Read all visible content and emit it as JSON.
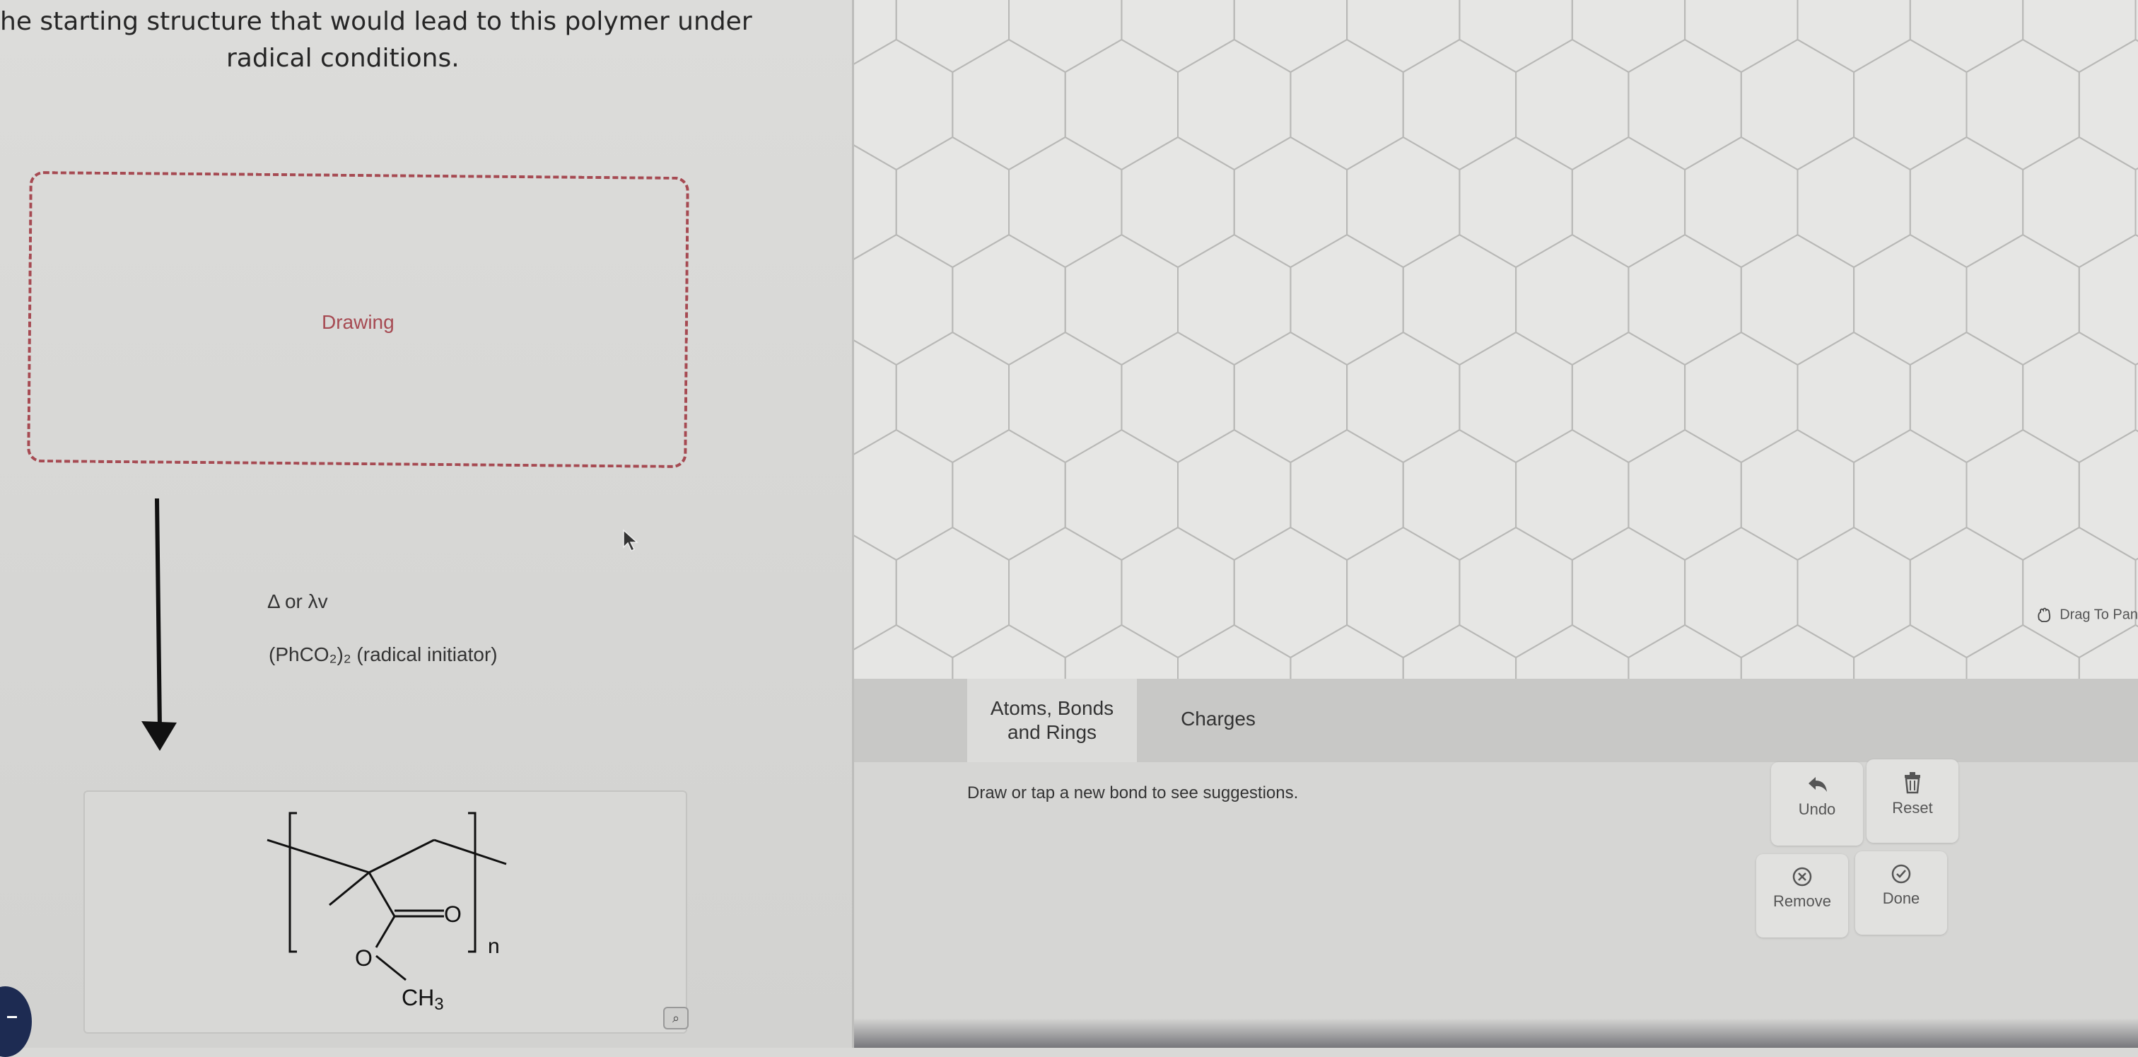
{
  "question": {
    "line1": "he starting structure that would lead to this polymer under",
    "line2": "radical conditions."
  },
  "drawing_placeholder": "Drawing",
  "conditions": {
    "heat_or_light": "Δ or λv",
    "initiator": "(PhCO₂)₂ (radical initiator)"
  },
  "product": {
    "carbonyl_oxygen": "O",
    "ester_oxygen": "O",
    "methyl": "CH",
    "methyl_sub": "3",
    "repeat": "n"
  },
  "editor": {
    "drag_hint": "Drag To Pan",
    "tabs": [
      {
        "label": "Atoms, Bonds and Rings",
        "selected": true
      },
      {
        "label": "Charges",
        "selected": false
      }
    ],
    "suggestion": "Draw or tap a new bond to see suggestions.",
    "buttons": {
      "undo": "Undo",
      "reset": "Reset",
      "remove": "Remove",
      "done": "Done"
    }
  },
  "colors": {
    "dashed_border": "#a64a52",
    "hex_grid_line": "#b8b8b6"
  },
  "icons": [
    "cursor-icon",
    "zoom-icon",
    "hand-icon",
    "undo-icon",
    "trash-icon",
    "remove-icon",
    "check-icon"
  ]
}
